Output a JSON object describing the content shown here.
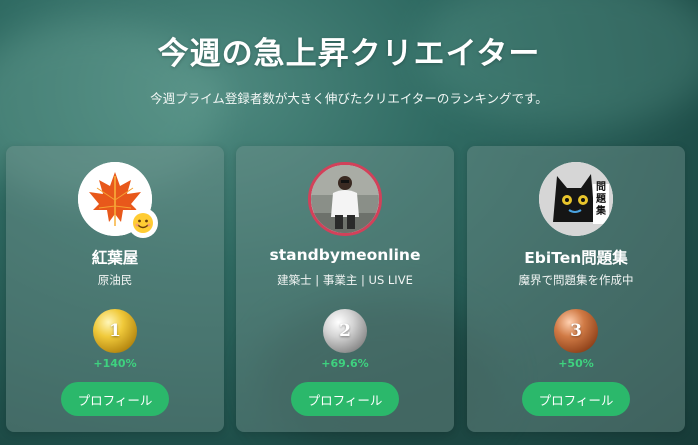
{
  "header": {
    "title": "今週の急上昇クリエイター",
    "subtitle": "今週プライム登録者数が大きく伸びたクリエイターのランキングです。"
  },
  "creators": [
    {
      "name": "紅葉屋",
      "tagline": "原油民",
      "rank": "1",
      "growth": "+140%",
      "button_label": "プロフィール",
      "avatar_icon": "maple-leaf-icon",
      "badge_icon": "smiley-emoji-icon",
      "medal_color": "#d4a017"
    },
    {
      "name": "standbymeonline",
      "tagline": "建築士 | 事業主 | US LIVE",
      "rank": "2",
      "growth": "+69.6%",
      "button_label": "プロフィール",
      "avatar_icon": "person-photo-icon",
      "ring_color": "#d2415a",
      "medal_color": "#a9a9a9"
    },
    {
      "name": "EbiTen問題集",
      "tagline": "魔界で問題集を作成中",
      "rank": "3",
      "growth": "+50%",
      "button_label": "プロフィール",
      "avatar_icon": "black-cat-icon",
      "avatar_text": "問題集",
      "medal_color": "#b0643a"
    }
  ],
  "colors": {
    "accent": "#2bb86b",
    "growth": "#3ed27f"
  }
}
